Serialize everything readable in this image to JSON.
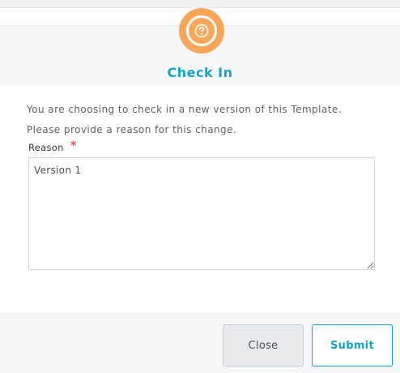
{
  "dialog": {
    "title": "Check In",
    "icon": "question-circle-icon",
    "icon_color": "#f7a65a",
    "title_color": "#14a3cc"
  },
  "message": {
    "line1": "You are choosing to check in a new version of this Template.",
    "line2": "Please provide a reason for this change."
  },
  "reason_field": {
    "label": "Reason",
    "required_mark": "*",
    "required_color": "#e0524b",
    "value": "Version 1"
  },
  "buttons": {
    "close_label": "Close",
    "submit_label": "Submit",
    "submit_color": "#14a3cc"
  }
}
